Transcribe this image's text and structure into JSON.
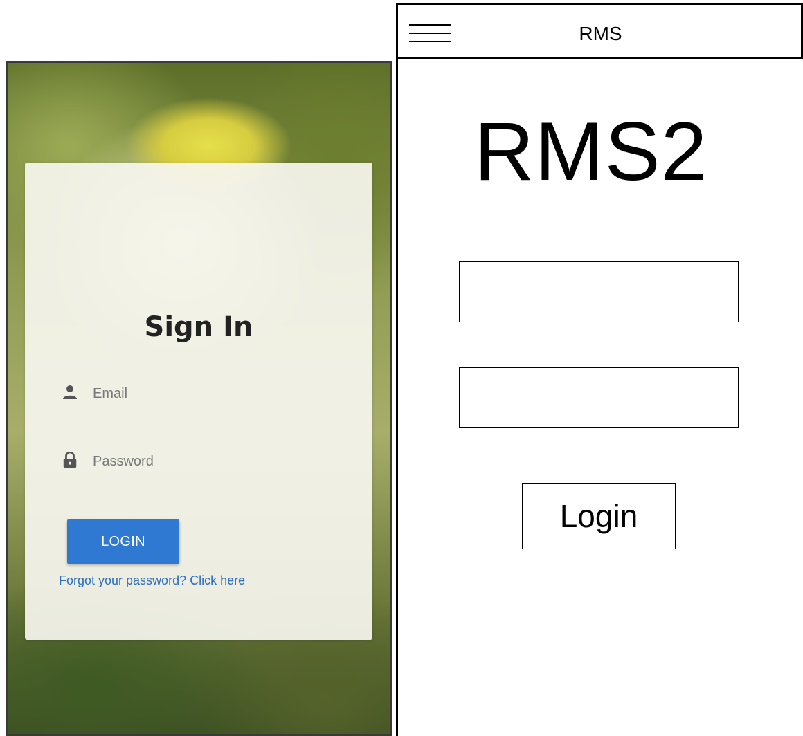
{
  "styled_login": {
    "title": "Sign In",
    "email": {
      "placeholder": "Email",
      "value": ""
    },
    "password": {
      "placeholder": "Password",
      "value": ""
    },
    "login_label": "LOGIN",
    "forgot_link": "Forgot your password? Click here",
    "icons": {
      "email": "person-icon",
      "password": "lock-icon"
    },
    "colors": {
      "button": "#2f79d3",
      "link": "#2c6fbd"
    }
  },
  "wireframe": {
    "header_title": "RMS",
    "menu_icon": "hamburger-menu-icon",
    "app_title": "RMS2",
    "login_label": "Login"
  }
}
